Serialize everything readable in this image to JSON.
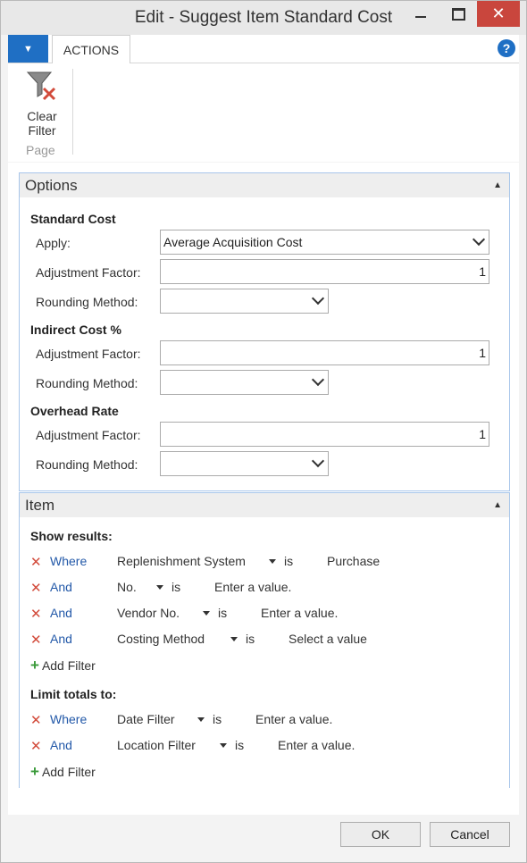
{
  "window": {
    "title": "Edit - Suggest Item Standard Cost",
    "close_glyph": "✕"
  },
  "ribbon": {
    "tab_actions": "ACTIONS",
    "help_glyph": "?",
    "app_menu_glyph": "▼",
    "clear_filter_label": "Clear Filter",
    "group_page": "Page"
  },
  "options": {
    "header": "Options",
    "standard_cost": {
      "title": "Standard Cost",
      "apply_label": "Apply:",
      "apply_value": "Average Acquisition Cost",
      "adj_label": "Adjustment Factor:",
      "adj_value": "1",
      "round_label": "Rounding Method:",
      "round_value": ""
    },
    "indirect_cost": {
      "title": "Indirect Cost %",
      "adj_label": "Adjustment Factor:",
      "adj_value": "1",
      "round_label": "Rounding Method:",
      "round_value": ""
    },
    "overhead_rate": {
      "title": "Overhead Rate",
      "adj_label": "Adjustment Factor:",
      "adj_value": "1",
      "round_label": "Rounding Method:",
      "round_value": ""
    }
  },
  "item": {
    "header": "Item",
    "show_results": {
      "title": "Show results:",
      "filters": [
        {
          "op": "Where",
          "field": "Replenishment System",
          "is": "is",
          "value": "Purchase"
        },
        {
          "op": "And",
          "field": "No.",
          "is": "is",
          "value": "Enter a value."
        },
        {
          "op": "And",
          "field": "Vendor No.",
          "is": "is",
          "value": "Enter a value."
        },
        {
          "op": "And",
          "field": "Costing Method",
          "is": "is",
          "value": "Select a value"
        }
      ],
      "add_filter": "Add Filter"
    },
    "limit_totals": {
      "title": "Limit totals to:",
      "filters": [
        {
          "op": "Where",
          "field": "Date Filter",
          "is": "is",
          "value": "Enter a value."
        },
        {
          "op": "And",
          "field": "Location Filter",
          "is": "is",
          "value": "Enter a value."
        }
      ],
      "add_filter": "Add Filter"
    }
  },
  "footer": {
    "ok_label": "OK",
    "cancel_label": "Cancel"
  },
  "icons": {
    "remove_filter": "remove-filter-icon",
    "add_filter": "add-filter-icon",
    "clear_filter": "clear-filter-icon"
  },
  "colors": {
    "accent": "#1f6fc4",
    "close": "#c9463d",
    "link": "#2258a8",
    "remove": "#d24b3b",
    "add": "#3a9a3a"
  }
}
